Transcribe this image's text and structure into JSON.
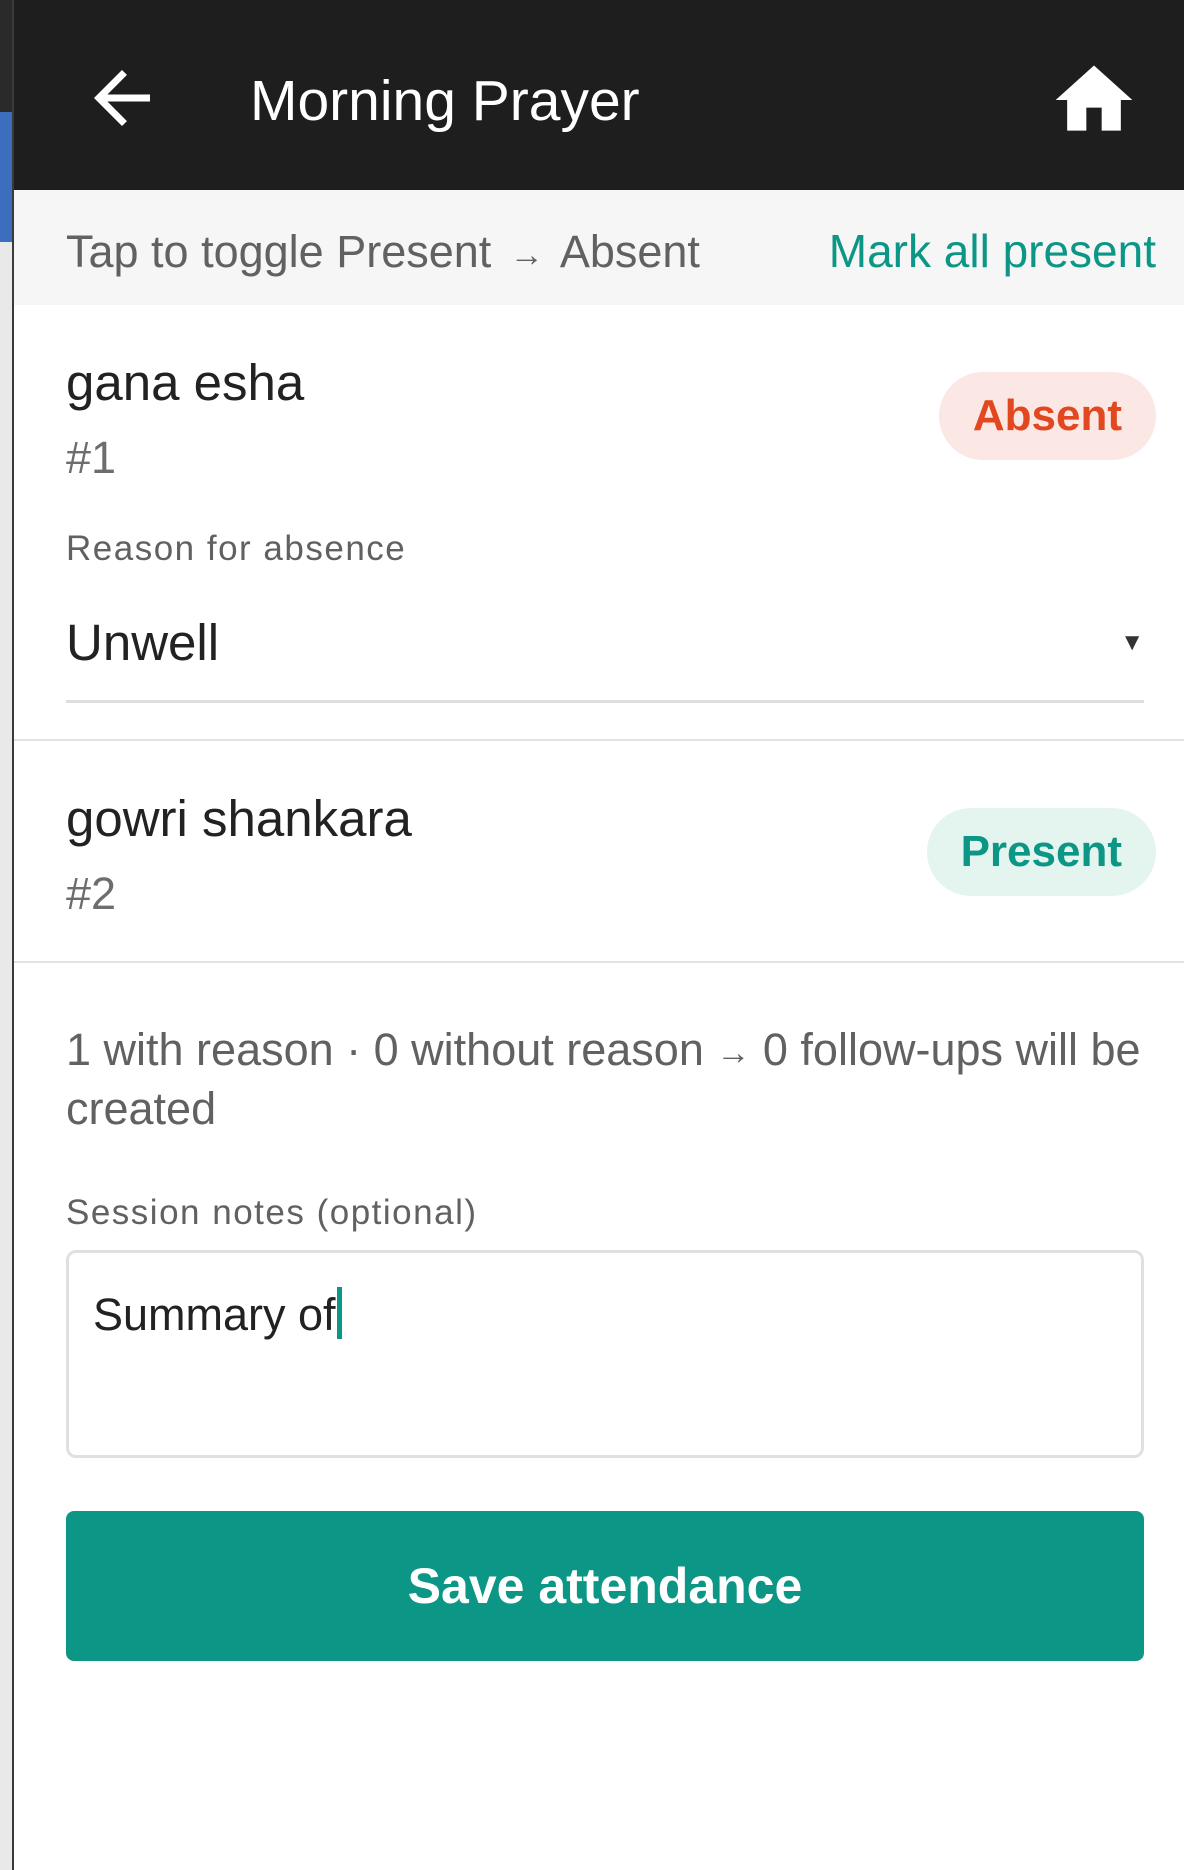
{
  "appbar": {
    "title": "Morning Prayer",
    "back_icon": "arrow-left-icon",
    "home_icon": "home-icon"
  },
  "hint": {
    "prefix": "Tap to toggle Present",
    "arrow": "→",
    "suffix": "Absent",
    "mark_all_label": "Mark all present"
  },
  "members": [
    {
      "name": "gana esha",
      "number": "#1",
      "status": "Absent",
      "reason_label": "Reason for absence",
      "reason_value": "Unwell"
    },
    {
      "name": "gowri shankara",
      "number": "#2",
      "status": "Present"
    }
  ],
  "summary": {
    "part1": "1 with reason · 0 without reason",
    "arrow": "→",
    "part2": "0 follow-ups will be created"
  },
  "notes": {
    "label": "Session notes (optional)",
    "value": "Summary of"
  },
  "save_label": "Save attendance",
  "colors": {
    "appbar_bg": "#1e1e1e",
    "accent": "#0b9685",
    "absent_text": "#e2481f",
    "absent_bg": "#fbe7e3",
    "present_bg": "#e4f5ef"
  }
}
